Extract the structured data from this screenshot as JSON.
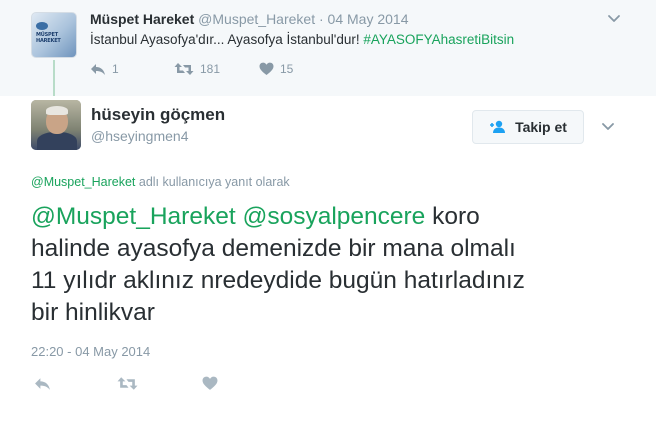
{
  "parent_tweet": {
    "name": "Müspet Hareket",
    "handle": "@Muspet_Hareket",
    "separator": "·",
    "date": "04 May 2014",
    "text": "İstanbul Ayasofya'dır... Ayasofya İstanbul'dur! ",
    "hashtag": "#AYASOFYAhasretiBitsin",
    "reply_count": "1",
    "retweet_count": "181",
    "like_count": "15",
    "avatar_logo_text": "MÜSPET HAREKET"
  },
  "tweet": {
    "name": "hüseyin göçmen",
    "handle": "@hseyingmen4",
    "follow_label": "Takip et",
    "reply_to_link": "@Muspet_Hareket",
    "reply_to_text": " adlı kullanıcıya yanıt olarak",
    "mention_1": "@Muspet_Hareket",
    "mention_2": "@sosyalpencere",
    "text_line_1_rest": " koro",
    "text_line_2": "halinde ayasofya demenizde bir mana olmalı",
    "text_line_3": "11 yılıdr aklınız nredeydide bugün hatırladınız",
    "text_line_4": "bir hinlikvar",
    "timestamp": "22:20 - 04 May 2014"
  },
  "colors": {
    "link": "#19a35c",
    "muted": "#8899a6",
    "text": "#292f33",
    "parent_bg": "#f5f8fa"
  },
  "icons": {
    "reply": "reply-arrow-icon",
    "retweet": "retweet-icon",
    "like": "heart-icon",
    "follow": "person-plus-icon",
    "more": "chevron-down-icon"
  }
}
